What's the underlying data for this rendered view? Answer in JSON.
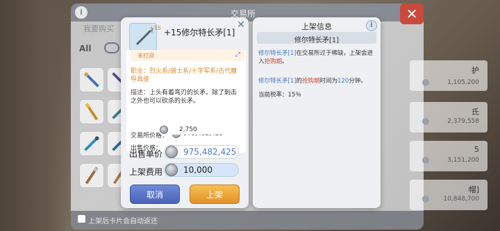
{
  "exchange": {
    "title": "交易所",
    "tab_my_buy": "我要购买",
    "tab_all": "All",
    "listings": [
      {
        "name": "护",
        "price": "1,105,200"
      },
      {
        "name": "氏",
        "price": "2,379,558"
      },
      {
        "name": "5",
        "price": "3,151,200"
      },
      {
        "name": "帽]",
        "price": "10,848,700"
      }
    ],
    "footer_note": "上架后卡片会自动返还"
  },
  "item_dialog": {
    "refine": "+15",
    "name": "+15修尔特长矛[1]",
    "status_text": "未打洞",
    "job_label": "职业：",
    "job_value": "烈火系/骑士系/十字军系/古代魔导具使",
    "desc_label": "描述：",
    "desc_value": "上头有着弯刃的长矛。除了刺击之外也可以砍杀的长矛。",
    "exchange_price_label": "交易所价格：",
    "exchange_price_value": "975,482,425",
    "sell_price_label": "出售价格：",
    "sell_price_value": "2,750",
    "unit_price_label": "出售单价",
    "unit_price_value": "975,482,425",
    "fee_label": "上架费用",
    "fee_value": "10,000",
    "cancel_label": "取消",
    "list_label": "上架"
  },
  "info_panel": {
    "title": "上架信息",
    "info_icon": "i",
    "subtitle": "修尔特长矛[1]",
    "p1_item": "修尔特长矛[1]",
    "p1_text": "在交易所过于稀缺，上架会进入",
    "p1_period": "抢购期",
    "p1_end": "。",
    "p2_item": "修尔特长矛[1]",
    "p2_mid1": "的",
    "p2_period": "抢购期",
    "p2_mid2": "时间为",
    "p2_minutes": "120",
    "p2_end": "分钟。",
    "tax": "当前税率：15％"
  },
  "colors": {
    "accent_blue": "#4a78c8",
    "accent_red": "#d04a3a",
    "accent_orange": "#e0882a"
  }
}
